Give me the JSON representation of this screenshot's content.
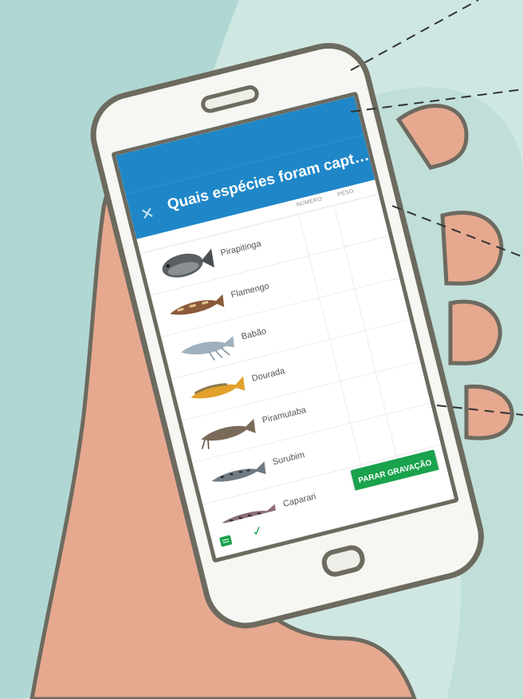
{
  "app": {
    "title": "Quais espécies foram captura...",
    "close_label": "✕"
  },
  "table": {
    "headers": [
      "NÚMERO",
      "PESO"
    ],
    "rows": [
      {
        "name": "Pirapitinga",
        "number": "",
        "weight": ""
      },
      {
        "name": "Flamengo",
        "number": "",
        "weight": ""
      },
      {
        "name": "Babão",
        "number": "",
        "weight": ""
      },
      {
        "name": "Dourada",
        "number": "",
        "weight": ""
      },
      {
        "name": "Piramutaba",
        "number": "",
        "weight": ""
      },
      {
        "name": "Surubim",
        "number": "",
        "weight": ""
      },
      {
        "name": "Caparari",
        "number": "",
        "weight": ""
      }
    ]
  },
  "bottom": {
    "stop_label": "PARAR GRAVAÇÃO",
    "check_label": "✓"
  },
  "icons": [
    "close-icon",
    "chat-icon",
    "check-icon"
  ],
  "colors": {
    "appbar": "#1f87c7",
    "accent": "#1aa24c",
    "phone_frame": "#6d6a60",
    "hand": "#e6a98f",
    "background": "#cfe7e2"
  }
}
